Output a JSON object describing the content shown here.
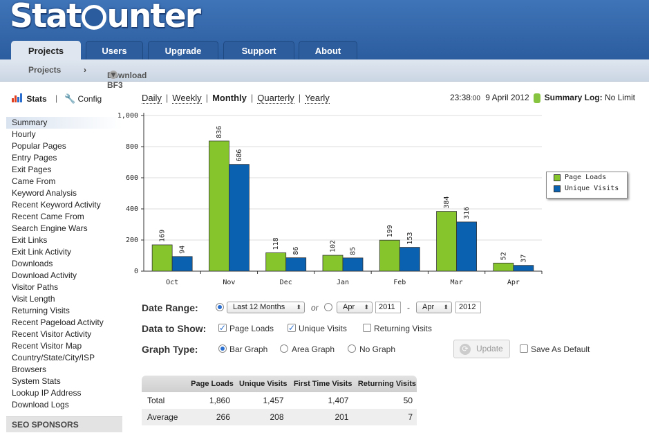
{
  "header": {
    "logo": {
      "part1": "Stat",
      "part2": "unter"
    },
    "tabs": [
      {
        "label": "Projects",
        "active": true
      },
      {
        "label": "Users",
        "active": false
      },
      {
        "label": "Upgrade",
        "active": false
      },
      {
        "label": "Support",
        "active": false
      },
      {
        "label": "About",
        "active": false
      }
    ]
  },
  "breadcrumb": {
    "root": "Projects",
    "separator": "›",
    "current": "Download BF3"
  },
  "sidebar": {
    "stats_label": "Stats",
    "divider": "|",
    "config_label": "Config",
    "items": [
      "Summary",
      "Hourly",
      "Popular Pages",
      "Entry Pages",
      "Exit Pages",
      "Came From",
      "Keyword Analysis",
      "Recent Keyword Activity",
      "Recent Came From",
      "Search Engine Wars",
      "Exit Links",
      "Exit Link Activity",
      "Downloads",
      "Download Activity",
      "Visitor Paths",
      "Visit Length",
      "Returning Visits",
      "Recent Pageload Activity",
      "Recent Visitor Activity",
      "Recent Visitor Map",
      "Country/State/City/ISP",
      "Browsers",
      "System Stats",
      "Lookup IP Address",
      "Download Logs"
    ],
    "active_item": "Summary",
    "sponsors": "SEO SPONSORS"
  },
  "periods": {
    "daily": "Daily",
    "weekly": "Weekly",
    "monthly": "Monthly",
    "quarterly": "Quarterly",
    "yearly": "Yearly",
    "sep": "|",
    "current": "Monthly"
  },
  "status": {
    "time": "23:38",
    "seconds": ":00",
    "date": "9 April 2012",
    "log_label": "Summary Log:",
    "log_value": "No Limit"
  },
  "chart_data": {
    "type": "bar",
    "categories": [
      "Oct",
      "Nov",
      "Dec",
      "Jan",
      "Feb",
      "Mar",
      "Apr"
    ],
    "series": [
      {
        "name": "Page Loads",
        "values": [
          169,
          836,
          118,
          102,
          199,
          384,
          52
        ],
        "color": "#86c52c"
      },
      {
        "name": "Unique Visits",
        "values": [
          94,
          686,
          86,
          85,
          153,
          316,
          37
        ],
        "color": "#0a61b0"
      }
    ],
    "yticks": [
      "0",
      "200",
      "400",
      "600",
      "800",
      "1,000"
    ],
    "ylim": [
      0,
      1000
    ],
    "grid": true,
    "legend": "right"
  },
  "controls": {
    "date_range_label": "Date Range:",
    "range_select": "Last 12 Months",
    "or": "or",
    "from_month": "Apr",
    "from_year": "2011",
    "dash": "-",
    "to_month": "Apr",
    "to_year": "2012",
    "data_label": "Data to Show:",
    "page_loads": "Page Loads",
    "unique_visits": "Unique Visits",
    "returning_visits": "Returning Visits",
    "graph_label": "Graph Type:",
    "bar_graph": "Bar Graph",
    "area_graph": "Area Graph",
    "no_graph": "No Graph",
    "update": "Update",
    "save_default": "Save As Default"
  },
  "table": {
    "headers": [
      "",
      "Page Loads",
      "Unique Visits",
      "First Time Visits",
      "Returning Visits"
    ],
    "rows": [
      [
        "Total",
        "1,860",
        "1,457",
        "1,407",
        "50"
      ],
      [
        "Average",
        "266",
        "208",
        "201",
        "7"
      ]
    ]
  }
}
